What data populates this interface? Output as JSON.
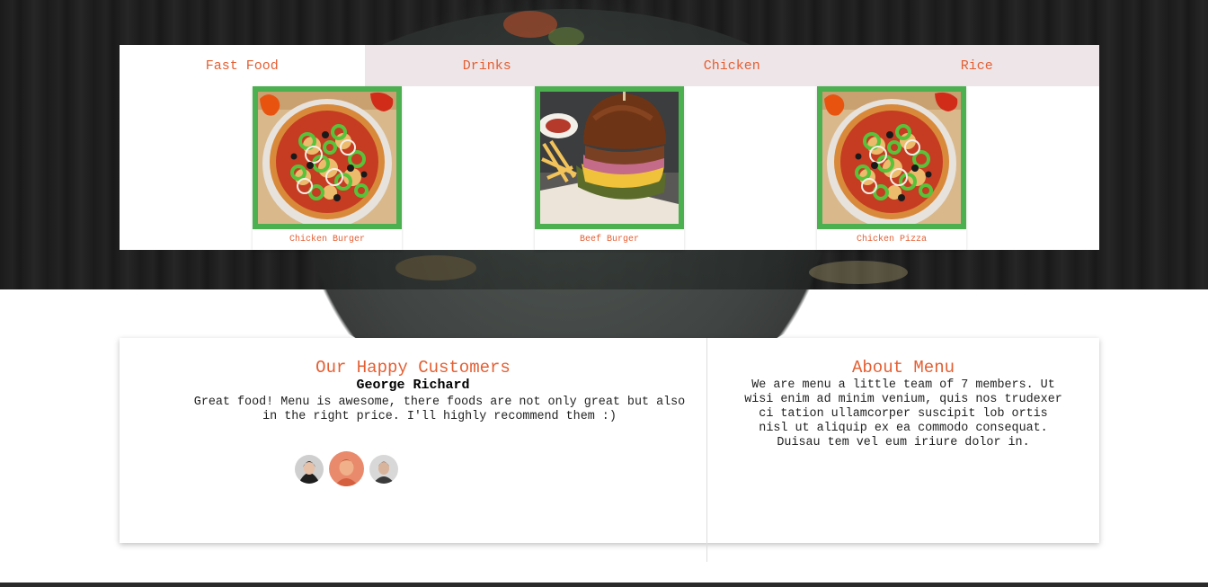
{
  "tabs": {
    "items": [
      {
        "label": "Fast Food"
      },
      {
        "label": "Drinks"
      },
      {
        "label": "Chicken"
      },
      {
        "label": "Rice"
      }
    ],
    "active": "Fast Food"
  },
  "menu_items": [
    {
      "name": "Chicken Burger",
      "image": "pizza"
    },
    {
      "name": "Beef Burger",
      "image": "burger"
    },
    {
      "name": "Chicken Pizza",
      "image": "pizza"
    }
  ],
  "customers": {
    "title": "Our Happy Customers",
    "name": "George Richard",
    "quote": "Great food! Menu is awesome, there foods are not only great but also in the right price. I'll highly recommend them :)"
  },
  "about": {
    "title": "About Menu",
    "text": "We are menu a little team of 7 members. Ut wisi enim ad minim venium, quis nos trudexer ci tation ullamcorper suscipit lob ortis nisl ut aliquip ex ea commodo consequat. Duisau tem vel eum iriure dolor in."
  },
  "colors": {
    "accent": "#e45f33",
    "frame": "#4caf50",
    "tab_bg": "#eee5e8"
  }
}
